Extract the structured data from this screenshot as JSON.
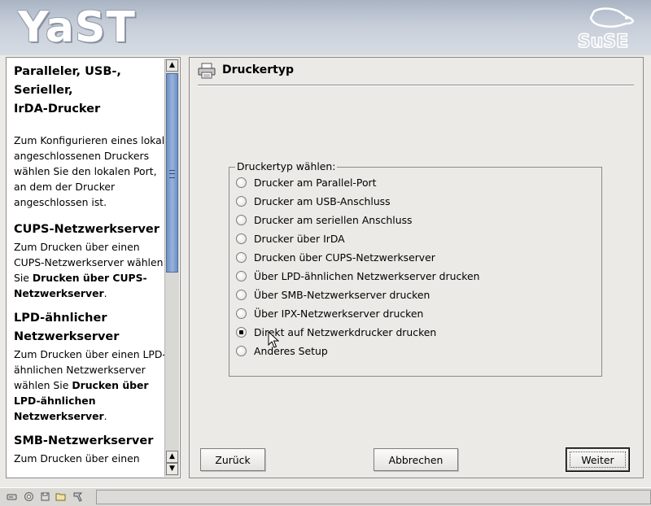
{
  "banner": {
    "logo_text": "YaST",
    "suse_logo_text": "SuSE"
  },
  "help": {
    "heading1_lines": [
      "Paralleler, USB-,",
      "Serieller,",
      "IrDA-Drucker"
    ],
    "para1": "Zum Konfigurieren eines lokal angeschlossenen Druckers wählen Sie den lokalen Port, an dem der Drucker angeschlossen ist.",
    "heading2": "CUPS-Netzwerkserver",
    "para2_plain": "Zum Drucken über einen CUPS-Netzwerkserver wählen Sie ",
    "para2_bold": "Drucken über CUPS-Netzwerkserver",
    "para2_end": ".",
    "heading3_lines": [
      "LPD-ähnlicher",
      "Netzwerkserver"
    ],
    "para3_plain": "Zum Drucken über einen LPD-ähnlichen Netzwerkserver wählen Sie ",
    "para3_bold": "Drucken über LPD-ähnlichen Netzwerkserver",
    "para3_end": ".",
    "heading4": "SMB-Netzwerkserver",
    "para4_partial": "Zum Drucken über einen"
  },
  "dialog": {
    "title": "Druckertyp",
    "group_label": "Druckertyp wählen:",
    "options": [
      {
        "label": "Drucker am Parallel-Port",
        "checked": false
      },
      {
        "label": "Drucker am USB-Anschluss",
        "checked": false
      },
      {
        "label": "Drucker am seriellen Anschluss",
        "checked": false
      },
      {
        "label": "Drucker über IrDA",
        "checked": false
      },
      {
        "label": "Drucken über CUPS-Netzwerkserver",
        "checked": false
      },
      {
        "label": "Über LPD-ähnlichen Netzwerkserver drucken",
        "checked": false
      },
      {
        "label": "Über SMB-Netzwerkserver drucken",
        "checked": false
      },
      {
        "label": "Über IPX-Netzwerkserver drucken",
        "checked": false
      },
      {
        "label": "Direkt auf Netzwerkdrucker drucken",
        "checked": true
      },
      {
        "label": "Anderes Setup",
        "checked": false
      }
    ],
    "buttons": {
      "back": "Zurück",
      "cancel": "Abbrechen",
      "next": "Weiter"
    }
  },
  "taskbar": {
    "icons": [
      "drive-icon",
      "settings-icon",
      "disk-icon",
      "folder-icon",
      "tools-icon"
    ]
  }
}
